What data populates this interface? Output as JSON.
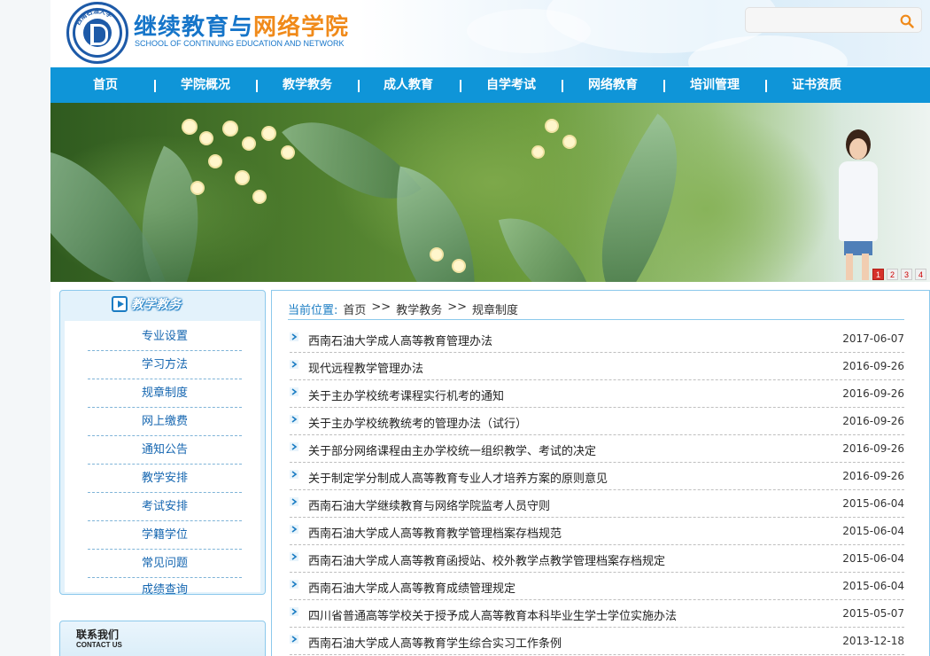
{
  "header": {
    "logo_text": "西南石油大学",
    "title_part1": "继续教育与",
    "title_part2": "网络学院",
    "subtitle": "SCHOOL OF CONTINUING EDUCATION AND NETWORK",
    "search": {
      "value": "",
      "placeholder": ""
    }
  },
  "nav": {
    "items": [
      "首页",
      "学院概况",
      "教学教务",
      "成人教育",
      "自学考试",
      "网络教育",
      "培训管理",
      "证书资质"
    ]
  },
  "banner": {
    "pages": [
      "1",
      "2",
      "3",
      "4"
    ],
    "active_page": 1
  },
  "sidebar": {
    "title": "教学教务",
    "items": [
      "专业设置",
      "学习方法",
      "规章制度",
      "网上缴费",
      "通知公告",
      "教学安排",
      "考试安排",
      "学籍学位",
      "常见问题",
      "成绩查询"
    ]
  },
  "contact": {
    "title": "联系我们",
    "subtitle": "CONTACT US"
  },
  "breadcrumb": {
    "label": "当前位置:",
    "items": [
      "首页",
      ">>",
      "教学教务",
      ">>",
      "规章制度"
    ]
  },
  "articles": [
    {
      "title": "西南石油大学成人高等教育管理办法",
      "date": "2017-06-07"
    },
    {
      "title": "现代远程教学管理办法",
      "date": "2016-09-26"
    },
    {
      "title": "关于主办学校统考课程实行机考的通知",
      "date": "2016-09-26"
    },
    {
      "title": "关于主办学校统教统考的管理办法（试行）",
      "date": "2016-09-26"
    },
    {
      "title": "关于部分网络课程由主办学校统一组织教学、考试的决定",
      "date": "2016-09-26"
    },
    {
      "title": "关于制定学分制成人高等教育专业人才培养方案的原则意见",
      "date": "2016-09-26"
    },
    {
      "title": "西南石油大学继续教育与网络学院监考人员守则",
      "date": "2015-06-04"
    },
    {
      "title": "西南石油大学成人高等教育教学管理档案存档规范",
      "date": "2015-06-04"
    },
    {
      "title": "西南石油大学成人高等教育函授站、校外教学点教学管理档案存档规定",
      "date": "2015-06-04"
    },
    {
      "title": "西南石油大学成人高等教育成绩管理规定",
      "date": "2015-06-04"
    },
    {
      "title": "四川省普通高等学校关于授予成人高等教育本科毕业生学士学位实施办法",
      "date": "2015-05-07"
    },
    {
      "title": "西南石油大学成人高等教育学生综合实习工作条例",
      "date": "2013-12-18"
    }
  ],
  "colors": {
    "nav_bg": "#0f95d8",
    "title_blue": "#1675c9",
    "title_orange": "#f08a1a",
    "sidebar_link": "#1566b0",
    "border_blue": "#8cc9ec",
    "page_active": "#d6322b"
  }
}
